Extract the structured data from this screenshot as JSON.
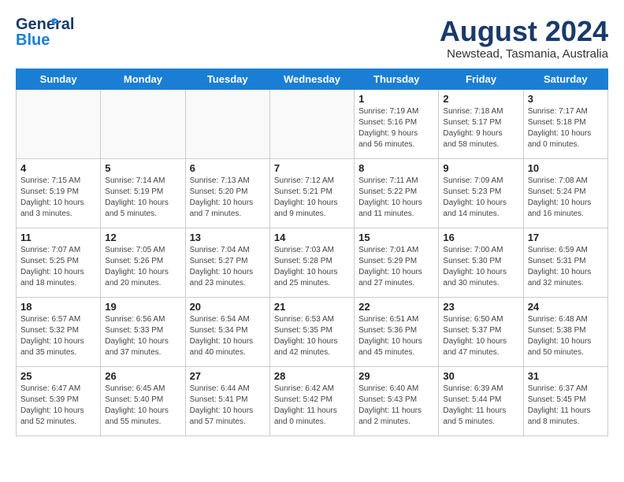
{
  "header": {
    "logo_general": "General",
    "logo_blue": "Blue",
    "month_title": "August 2024",
    "subtitle": "Newstead, Tasmania, Australia"
  },
  "weekdays": [
    "Sunday",
    "Monday",
    "Tuesday",
    "Wednesday",
    "Thursday",
    "Friday",
    "Saturday"
  ],
  "weeks": [
    {
      "days": [
        {
          "num": "",
          "info": ""
        },
        {
          "num": "",
          "info": ""
        },
        {
          "num": "",
          "info": ""
        },
        {
          "num": "",
          "info": ""
        },
        {
          "num": "1",
          "info": "Sunrise: 7:19 AM\nSunset: 5:16 PM\nDaylight: 9 hours\nand 56 minutes."
        },
        {
          "num": "2",
          "info": "Sunrise: 7:18 AM\nSunset: 5:17 PM\nDaylight: 9 hours\nand 58 minutes."
        },
        {
          "num": "3",
          "info": "Sunrise: 7:17 AM\nSunset: 5:18 PM\nDaylight: 10 hours\nand 0 minutes."
        }
      ]
    },
    {
      "days": [
        {
          "num": "4",
          "info": "Sunrise: 7:15 AM\nSunset: 5:19 PM\nDaylight: 10 hours\nand 3 minutes."
        },
        {
          "num": "5",
          "info": "Sunrise: 7:14 AM\nSunset: 5:19 PM\nDaylight: 10 hours\nand 5 minutes."
        },
        {
          "num": "6",
          "info": "Sunrise: 7:13 AM\nSunset: 5:20 PM\nDaylight: 10 hours\nand 7 minutes."
        },
        {
          "num": "7",
          "info": "Sunrise: 7:12 AM\nSunset: 5:21 PM\nDaylight: 10 hours\nand 9 minutes."
        },
        {
          "num": "8",
          "info": "Sunrise: 7:11 AM\nSunset: 5:22 PM\nDaylight: 10 hours\nand 11 minutes."
        },
        {
          "num": "9",
          "info": "Sunrise: 7:09 AM\nSunset: 5:23 PM\nDaylight: 10 hours\nand 14 minutes."
        },
        {
          "num": "10",
          "info": "Sunrise: 7:08 AM\nSunset: 5:24 PM\nDaylight: 10 hours\nand 16 minutes."
        }
      ]
    },
    {
      "days": [
        {
          "num": "11",
          "info": "Sunrise: 7:07 AM\nSunset: 5:25 PM\nDaylight: 10 hours\nand 18 minutes."
        },
        {
          "num": "12",
          "info": "Sunrise: 7:05 AM\nSunset: 5:26 PM\nDaylight: 10 hours\nand 20 minutes."
        },
        {
          "num": "13",
          "info": "Sunrise: 7:04 AM\nSunset: 5:27 PM\nDaylight: 10 hours\nand 23 minutes."
        },
        {
          "num": "14",
          "info": "Sunrise: 7:03 AM\nSunset: 5:28 PM\nDaylight: 10 hours\nand 25 minutes."
        },
        {
          "num": "15",
          "info": "Sunrise: 7:01 AM\nSunset: 5:29 PM\nDaylight: 10 hours\nand 27 minutes."
        },
        {
          "num": "16",
          "info": "Sunrise: 7:00 AM\nSunset: 5:30 PM\nDaylight: 10 hours\nand 30 minutes."
        },
        {
          "num": "17",
          "info": "Sunrise: 6:59 AM\nSunset: 5:31 PM\nDaylight: 10 hours\nand 32 minutes."
        }
      ]
    },
    {
      "days": [
        {
          "num": "18",
          "info": "Sunrise: 6:57 AM\nSunset: 5:32 PM\nDaylight: 10 hours\nand 35 minutes."
        },
        {
          "num": "19",
          "info": "Sunrise: 6:56 AM\nSunset: 5:33 PM\nDaylight: 10 hours\nand 37 minutes."
        },
        {
          "num": "20",
          "info": "Sunrise: 6:54 AM\nSunset: 5:34 PM\nDaylight: 10 hours\nand 40 minutes."
        },
        {
          "num": "21",
          "info": "Sunrise: 6:53 AM\nSunset: 5:35 PM\nDaylight: 10 hours\nand 42 minutes."
        },
        {
          "num": "22",
          "info": "Sunrise: 6:51 AM\nSunset: 5:36 PM\nDaylight: 10 hours\nand 45 minutes."
        },
        {
          "num": "23",
          "info": "Sunrise: 6:50 AM\nSunset: 5:37 PM\nDaylight: 10 hours\nand 47 minutes."
        },
        {
          "num": "24",
          "info": "Sunrise: 6:48 AM\nSunset: 5:38 PM\nDaylight: 10 hours\nand 50 minutes."
        }
      ]
    },
    {
      "days": [
        {
          "num": "25",
          "info": "Sunrise: 6:47 AM\nSunset: 5:39 PM\nDaylight: 10 hours\nand 52 minutes."
        },
        {
          "num": "26",
          "info": "Sunrise: 6:45 AM\nSunset: 5:40 PM\nDaylight: 10 hours\nand 55 minutes."
        },
        {
          "num": "27",
          "info": "Sunrise: 6:44 AM\nSunset: 5:41 PM\nDaylight: 10 hours\nand 57 minutes."
        },
        {
          "num": "28",
          "info": "Sunrise: 6:42 AM\nSunset: 5:42 PM\nDaylight: 11 hours\nand 0 minutes."
        },
        {
          "num": "29",
          "info": "Sunrise: 6:40 AM\nSunset: 5:43 PM\nDaylight: 11 hours\nand 2 minutes."
        },
        {
          "num": "30",
          "info": "Sunrise: 6:39 AM\nSunset: 5:44 PM\nDaylight: 11 hours\nand 5 minutes."
        },
        {
          "num": "31",
          "info": "Sunrise: 6:37 AM\nSunset: 5:45 PM\nDaylight: 11 hours\nand 8 minutes."
        }
      ]
    }
  ]
}
